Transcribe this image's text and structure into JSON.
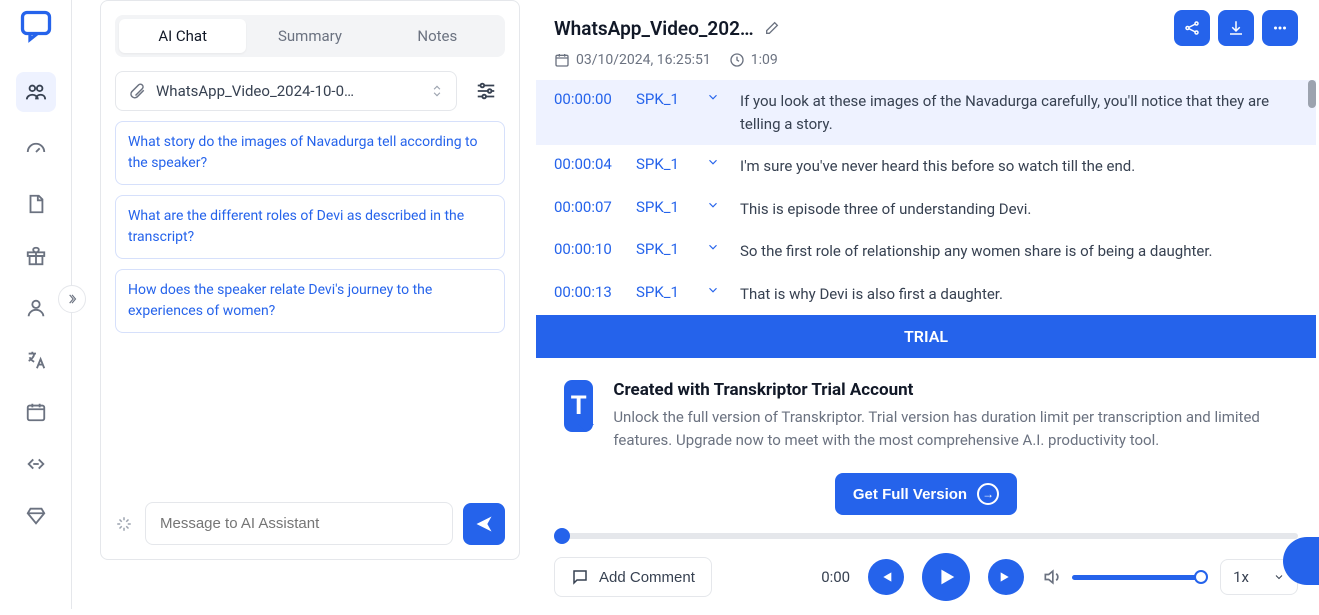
{
  "tabs": {
    "ai_chat": "AI Chat",
    "summary": "Summary",
    "notes": "Notes"
  },
  "file": {
    "name": "WhatsApp_Video_2024-10-0…"
  },
  "suggestions": [
    "What story do the images of Navadurga tell according to the speaker?",
    "What are the different roles of Devi as described in the transcript?",
    "How does the speaker relate Devi's journey to the experiences of women?"
  ],
  "input": {
    "placeholder": "Message to AI Assistant"
  },
  "header": {
    "title": "WhatsApp_Video_202…",
    "date": "03/10/2024, 16:25:51",
    "duration": "1:09"
  },
  "transcript": [
    {
      "ts": "00:00:00",
      "spk": "SPK_1",
      "text": "If you look at these images of the Navadurga carefully, you'll notice that they are telling a story."
    },
    {
      "ts": "00:00:04",
      "spk": "SPK_1",
      "text": "I'm sure you've never heard this before so watch till the end."
    },
    {
      "ts": "00:00:07",
      "spk": "SPK_1",
      "text": "This is episode three of understanding Devi."
    },
    {
      "ts": "00:00:10",
      "spk": "SPK_1",
      "text": "So the first role of relationship any women share is of being a daughter."
    },
    {
      "ts": "00:00:13",
      "spk": "SPK_1",
      "text": "That is why Devi is also first a daughter."
    }
  ],
  "trial": {
    "banner": "TRIAL",
    "heading": "Created with Transkriptor Trial Account",
    "body": "Unlock the full version of Transkriptor. Trial version has duration limit per transcription and limited features. Upgrade now to meet with the most comprehensive A.I. productivity tool.",
    "cta": "Get Full Version",
    "logo_letter": "T"
  },
  "player": {
    "time": "0:00",
    "speed": "1x",
    "add_comment": "Add Comment"
  }
}
